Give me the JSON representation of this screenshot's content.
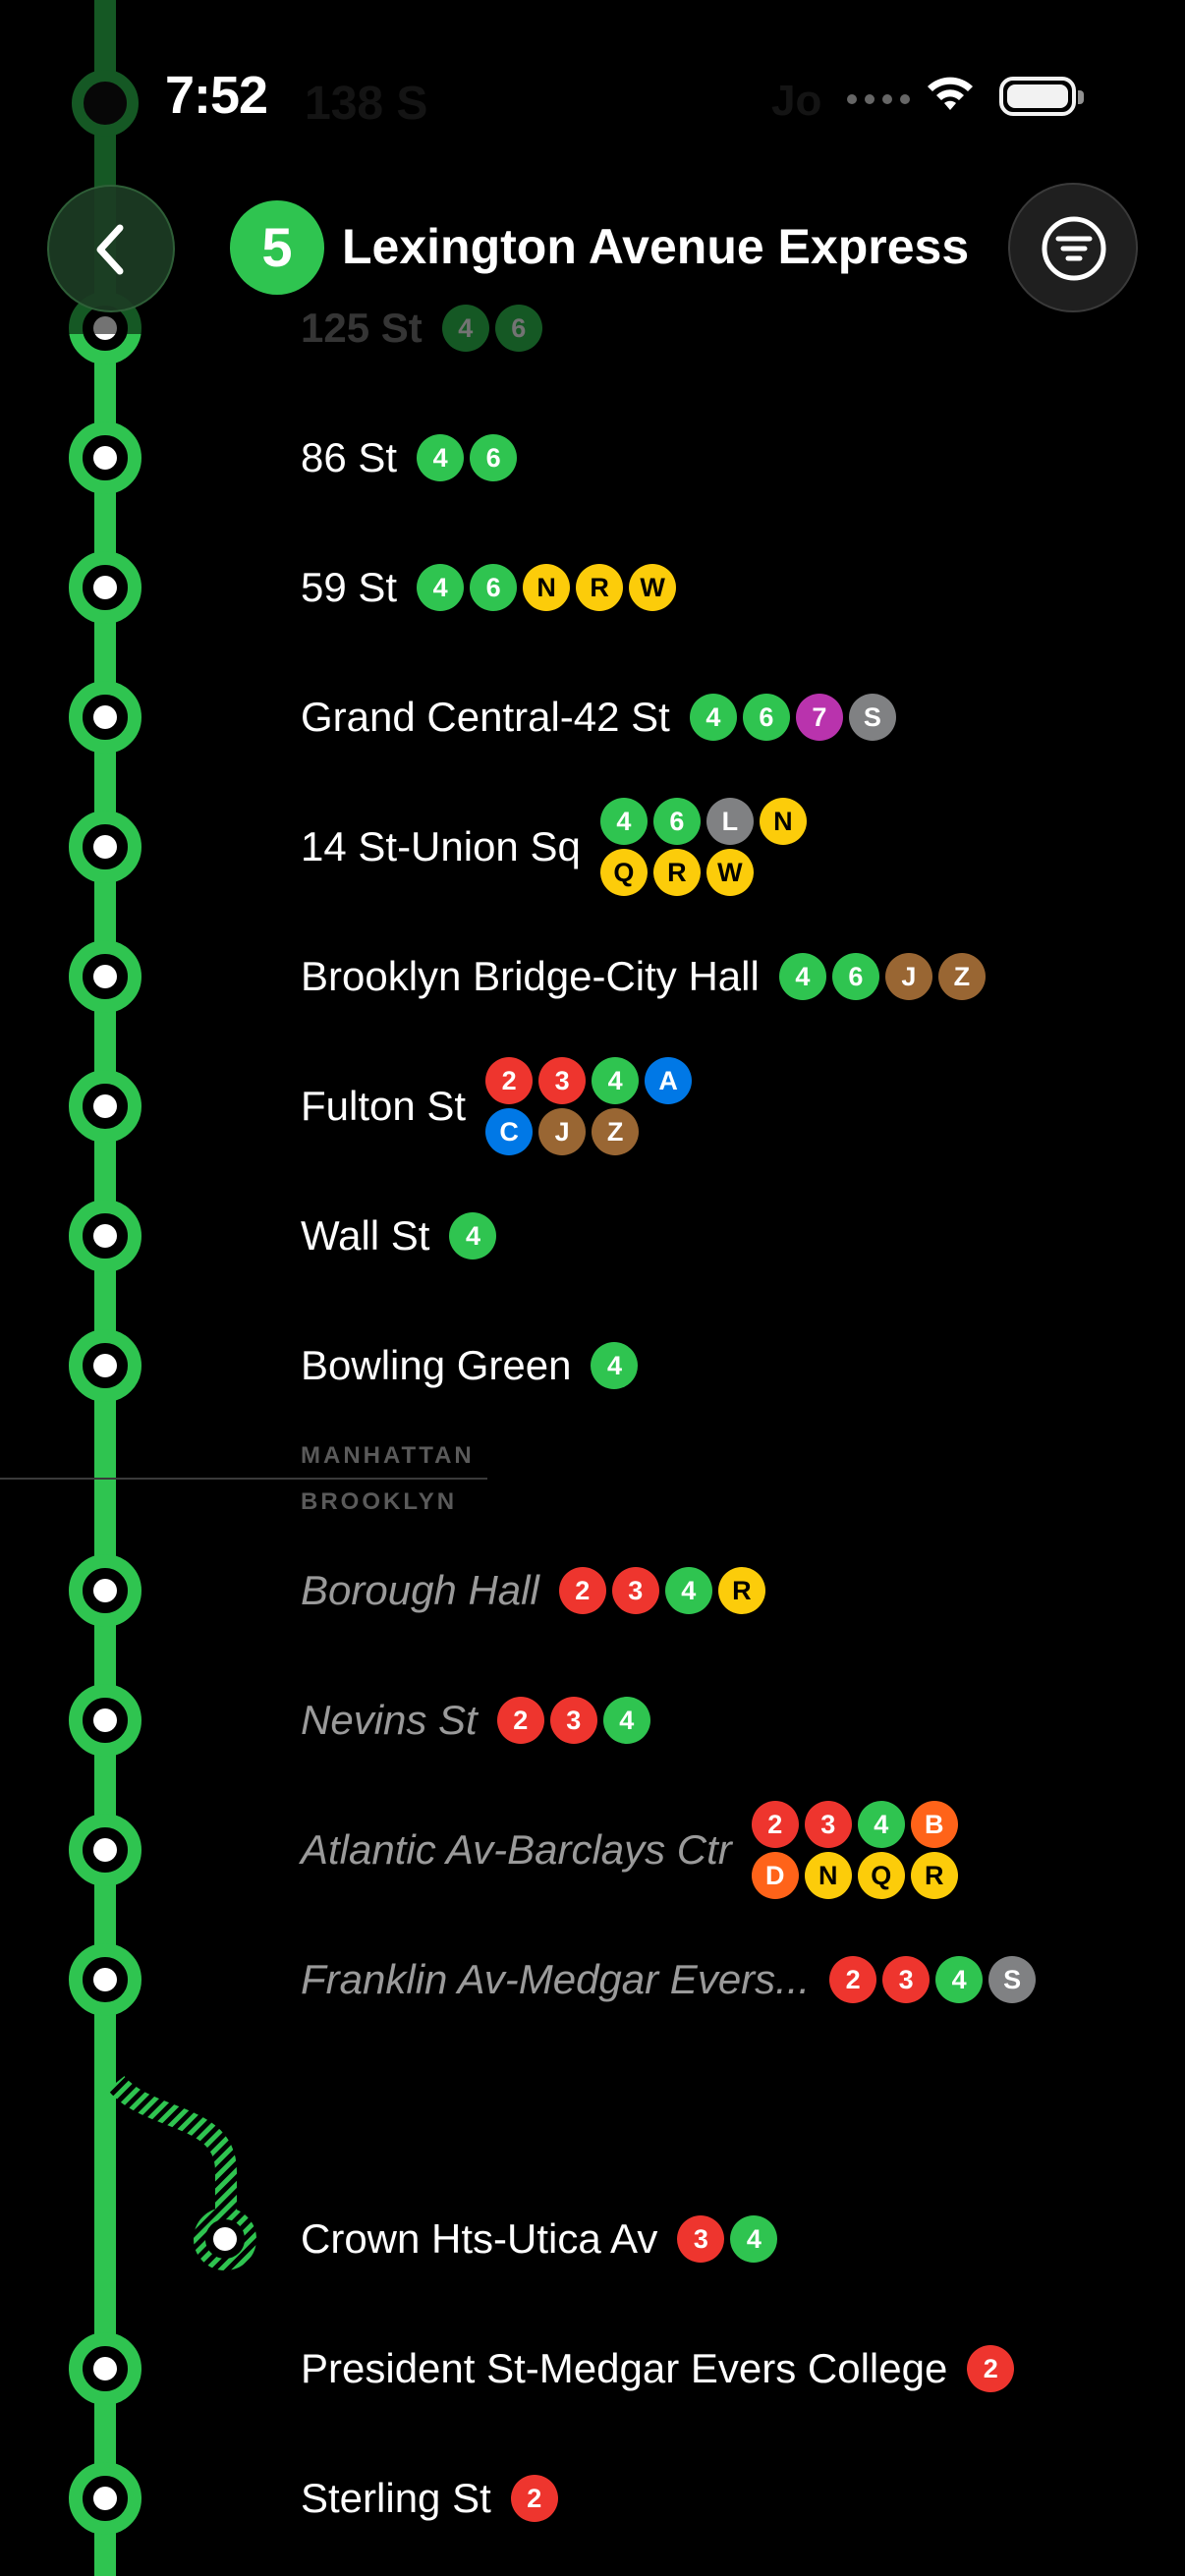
{
  "status_bar": {
    "time": "7:52",
    "ghost_station": "138 S",
    "ghost_right": "Jo"
  },
  "header": {
    "route_number": "5",
    "route_color": "#2fc450",
    "title": "Lexington Avenue Express",
    "back_icon": "chevron-left-icon",
    "filter_icon": "filter-icon"
  },
  "line_color": "#2fc450",
  "route_colors": {
    "2": "#ee352e",
    "3": "#ee352e",
    "4": "#2fc450",
    "6": "#2fc450",
    "7": "#b933ad",
    "S": "#808183",
    "L": "#808183",
    "N": "#fccc0a",
    "Q": "#fccc0a",
    "R": "#fccc0a",
    "W": "#fccc0a",
    "J": "#996633",
    "Z": "#996633",
    "A": "#0078e6",
    "C": "#0078e6",
    "B": "#ff6319",
    "D": "#ff6319"
  },
  "stations": [
    {
      "name": "125 St",
      "routes": [
        "4",
        "6"
      ],
      "style": "faded"
    },
    {
      "name": "86 St",
      "routes": [
        "4",
        "6"
      ],
      "style": "normal"
    },
    {
      "name": "59 St",
      "routes": [
        "4",
        "6",
        "N",
        "R",
        "W"
      ],
      "style": "normal"
    },
    {
      "name": "Grand Central-42 St",
      "routes": [
        "4",
        "6",
        "7",
        "S"
      ],
      "style": "normal"
    },
    {
      "name": "14 St-Union Sq",
      "routes": [
        "4",
        "6",
        "L",
        "N",
        "Q",
        "R",
        "W"
      ],
      "style": "normal"
    },
    {
      "name": "Brooklyn Bridge-City Hall",
      "routes": [
        "4",
        "6",
        "J",
        "Z"
      ],
      "style": "normal"
    },
    {
      "name": "Fulton St",
      "routes": [
        "2",
        "3",
        "4",
        "A",
        "C",
        "J",
        "Z"
      ],
      "style": "normal"
    },
    {
      "name": "Wall St",
      "routes": [
        "4"
      ],
      "style": "normal"
    },
    {
      "name": "Bowling Green",
      "routes": [
        "4"
      ],
      "style": "normal"
    },
    {
      "name": "Borough Hall",
      "routes": [
        "2",
        "3",
        "4",
        "R"
      ],
      "style": "italic"
    },
    {
      "name": "Nevins St",
      "routes": [
        "2",
        "3",
        "4"
      ],
      "style": "italic"
    },
    {
      "name": "Atlantic Av-Barclays Ctr",
      "routes": [
        "2",
        "3",
        "4",
        "B",
        "D",
        "N",
        "Q",
        "R"
      ],
      "style": "italic"
    },
    {
      "name": "Franklin Av-Medgar Evers...",
      "routes": [
        "2",
        "3",
        "4",
        "S"
      ],
      "style": "italic"
    },
    {
      "name": "Crown Hts-Utica Av",
      "routes": [
        "3",
        "4"
      ],
      "style": "normal"
    },
    {
      "name": "President St-Medgar Evers College",
      "routes": [
        "2"
      ],
      "style": "normal"
    },
    {
      "name": "Sterling St",
      "routes": [
        "2"
      ],
      "style": "normal"
    }
  ],
  "boroughs": {
    "above": "MANHATTAN",
    "below": "BROOKLYN"
  }
}
